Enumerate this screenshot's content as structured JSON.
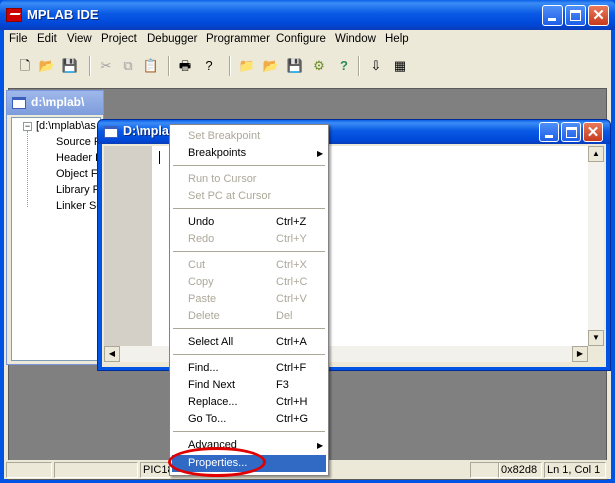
{
  "app": {
    "title": "MPLAB IDE"
  },
  "menu": [
    "File",
    "Edit",
    "View",
    "Project",
    "Debugger",
    "Programmer",
    "Configure",
    "Window",
    "Help"
  ],
  "toolbar": {
    "icons": [
      "new-file-icon",
      "open-folder-icon",
      "save-icon",
      "cut-icon",
      "copy-icon",
      "paste-icon",
      "print-icon",
      "help-icon",
      "new-project-icon",
      "open-project-icon",
      "save-project-icon",
      "build-icon",
      "help-icon-2",
      "build-all-icon",
      "make-icon"
    ]
  },
  "project_window": {
    "title": "d:\\mplab\\",
    "root": "[d:\\mplab\\as",
    "folders": [
      "Source F",
      "Header F",
      "Object F",
      "Library F",
      "Linker Sc"
    ]
  },
  "editor_window": {
    "title": "D:\\mplab\\asm\\prvi.asm*"
  },
  "context_menu": {
    "items": [
      {
        "label": "Set Breakpoint",
        "shortcut": "",
        "disabled": true
      },
      {
        "label": "Breakpoints",
        "shortcut": "",
        "submenu": true
      },
      {
        "label": "Run to Cursor",
        "shortcut": "",
        "disabled": true
      },
      {
        "label": "Set PC at Cursor",
        "shortcut": "",
        "disabled": true
      },
      {
        "label": "Undo",
        "shortcut": "Ctrl+Z"
      },
      {
        "label": "Redo",
        "shortcut": "Ctrl+Y",
        "disabled": true
      },
      {
        "label": "Cut",
        "shortcut": "Ctrl+X",
        "disabled": true
      },
      {
        "label": "Copy",
        "shortcut": "Ctrl+C",
        "disabled": true
      },
      {
        "label": "Paste",
        "shortcut": "Ctrl+V",
        "disabled": true
      },
      {
        "label": "Delete",
        "shortcut": "Del",
        "disabled": true
      },
      {
        "label": "Select All",
        "shortcut": "Ctrl+A"
      },
      {
        "label": "Find...",
        "shortcut": "Ctrl+F"
      },
      {
        "label": "Find Next",
        "shortcut": "F3"
      },
      {
        "label": "Replace...",
        "shortcut": "Ctrl+H"
      },
      {
        "label": "Go To...",
        "shortcut": "Ctrl+G"
      },
      {
        "label": "Advanced",
        "shortcut": "",
        "submenu": true
      },
      {
        "label": "Properties...",
        "shortcut": "",
        "selected": true
      }
    ]
  },
  "statusbar": {
    "device": "PIC18",
    "address": "0x82d8",
    "position": "Ln 1, Col 1"
  },
  "colors": {
    "xp_blue": "#0054e3",
    "selection": "#316ac5",
    "highlight_circle": "#e00000"
  }
}
